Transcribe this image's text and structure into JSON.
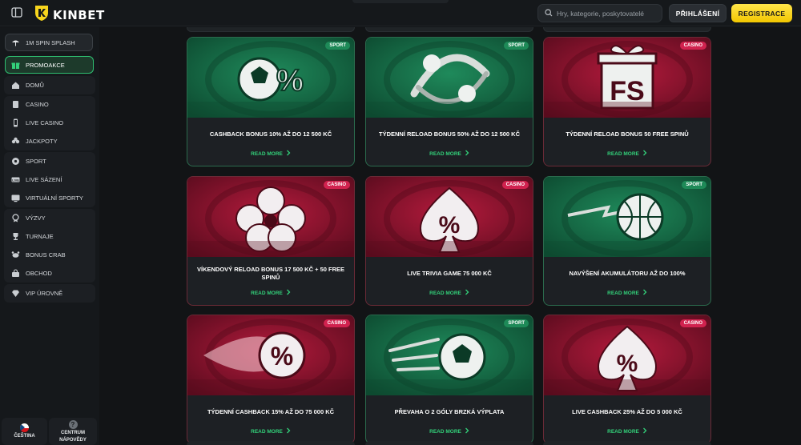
{
  "header": {
    "brand": "KINBET",
    "search_placeholder": "Hry, kategorie, poskytovatelé",
    "login_label": "PŘIHLÁŠENÍ",
    "register_label": "REGISTRACE"
  },
  "sidebar": {
    "spin_label": "1M SPIN SPLASH",
    "promo_label": "PROMOAKCE",
    "home_label": "DOMŮ",
    "casino_group": [
      "CASINO",
      "LIVE CASINO",
      "JACKPOTY"
    ],
    "sport_group": [
      "SPORT",
      "LIVE SÁZENÍ",
      "VIRTUÁLNÍ SPORTY"
    ],
    "extras_group": [
      "VÝZVY",
      "TURNAJE",
      "BONUS CRAB",
      "OBCHOD"
    ],
    "vip_label": "VIP ÚROVNĚ",
    "language_label": "ČEŠTINA",
    "help_label_1": "CENTRUM",
    "help_label_2": "NÁPOVĚDY"
  },
  "colors": {
    "accent_green": "#33d17a",
    "brand_yellow": "#f7d51d",
    "badge_sport": "#1e8a58",
    "badge_casino": "#d1224f"
  },
  "cards": [
    {
      "badge": "SPORT",
      "title": "CASHBACK BONUS 10% AŽ DO 12 500 KČ",
      "cta": "READ MORE",
      "theme": "green",
      "art": "soccer-percent-icon"
    },
    {
      "badge": "SPORT",
      "title": "TÝDENNÍ RELOAD BONUS 50% AŽ DO 12 500 KČ",
      "cta": "READ MORE",
      "theme": "green",
      "art": "baseball-swirl-icon"
    },
    {
      "badge": "CASINO",
      "title": "TÝDENNÍ RELOAD BONUS 50 FREE SPINŮ",
      "cta": "READ MORE",
      "theme": "red",
      "art": "gift-fs-icon"
    },
    {
      "badge": "CASINO",
      "title": "VÍKENDOVÝ RELOAD BONUS 17 500 KČ + 50 FREE SPINŮ",
      "cta": "READ MORE",
      "theme": "red",
      "art": "clover-icon"
    },
    {
      "badge": "CASINO",
      "title": "LIVE TRIVIA GAME 75 000 KČ",
      "cta": "READ MORE",
      "theme": "red",
      "art": "spade-percent-icon"
    },
    {
      "badge": "SPORT",
      "title": "NAVÝŠENÍ AKUMULÁTORU AŽ DO 100%",
      "cta": "READ MORE",
      "theme": "green",
      "art": "basketball-icon"
    },
    {
      "badge": "CASINO",
      "title": "TÝDENNÍ CASHBACK 15% AŽ DO 75 000 KČ",
      "cta": "READ MORE",
      "theme": "red",
      "art": "percent-fireball-icon"
    },
    {
      "badge": "SPORT",
      "title": "PŘEVAHA O 2 GÓLY BRZKÁ VÝPLATA",
      "cta": "READ MORE",
      "theme": "green",
      "art": "soccer-ball-icon"
    },
    {
      "badge": "CASINO",
      "title": "LIVE CASHBACK 25% AŽ DO 5 000 KČ",
      "cta": "READ MORE",
      "theme": "red",
      "art": "spade-percent-icon"
    }
  ]
}
